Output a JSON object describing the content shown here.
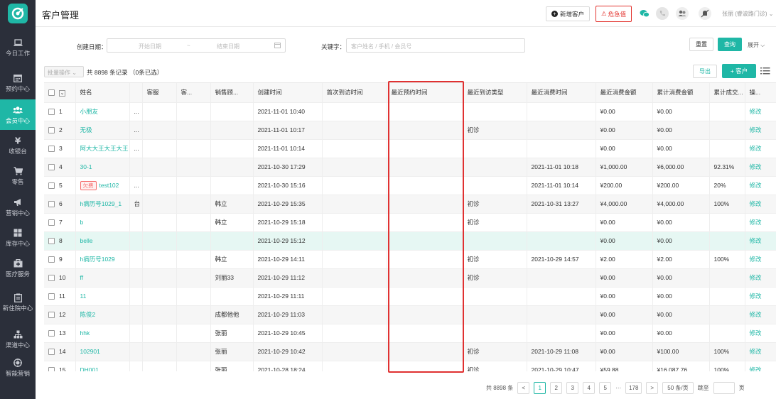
{
  "sidebar": {
    "items": [
      {
        "label": "今日工作",
        "icon": "laptop-icon"
      },
      {
        "label": "预约中心",
        "icon": "calendar-icon"
      },
      {
        "label": "会员中心",
        "icon": "members-icon",
        "active": true
      },
      {
        "label": "收银台",
        "icon": "yen-icon"
      },
      {
        "label": "零售",
        "icon": "cart-icon"
      },
      {
        "label": "营销中心",
        "icon": "megaphone-icon"
      },
      {
        "label": "库存中心",
        "icon": "grid-icon"
      },
      {
        "label": "医疗服务",
        "icon": "medkit-icon"
      },
      {
        "label": "住院中心",
        "icon": "clipboard-icon",
        "prefix": "新"
      },
      {
        "label": "渠道中心",
        "icon": "org-icon"
      },
      {
        "label": "智能营销",
        "icon": "target-icon"
      }
    ]
  },
  "header": {
    "title": "客户管理",
    "add_button": "新增客户",
    "urgent_button": "危急值",
    "user": "张丽 (睿波路门诊)"
  },
  "filter": {
    "date_label": "创建日期：",
    "start_placeholder": "开始日期",
    "range_sep": "~",
    "end_placeholder": "结束日期",
    "keyword_label": "关键字：",
    "keyword_placeholder": "客户姓名 / 手机 / 会员号",
    "reset": "重置",
    "query": "查询",
    "expand": "展开"
  },
  "toolbar": {
    "batch": "批量操作",
    "record_count": "共 8898 条记录 （0条已选）",
    "export": "导出",
    "new_customer": "+ 客户"
  },
  "table": {
    "columns": [
      "",
      "姓名",
      "",
      "客服",
      "客...",
      "销售顾...",
      "创建时间",
      "首次到访时间",
      "最近预约时间",
      "最近到访类型",
      "最近消费时间",
      "最近消费金额",
      "累计消费金额",
      "累计成交...",
      "操..."
    ],
    "rows": [
      {
        "no": "1",
        "name": "小朋友",
        "extra": "...",
        "sales": "",
        "created": "2021-11-01 10:40",
        "first": "",
        "appt": "",
        "type": "",
        "last_time": "",
        "last_amt": "¥0.00",
        "total_amt": "¥0.00",
        "rate": "",
        "op": "修改"
      },
      {
        "no": "2",
        "name": "无极",
        "extra": "...",
        "sales": "",
        "created": "2021-11-01 10:17",
        "first": "",
        "appt": "",
        "type": "初诊",
        "last_time": "",
        "last_amt": "¥0.00",
        "total_amt": "¥0.00",
        "rate": "",
        "op": "修改"
      },
      {
        "no": "3",
        "name": "阿大大王大王大王",
        "extra": "...",
        "sales": "",
        "created": "2021-11-01 10:14",
        "first": "",
        "appt": "",
        "type": "",
        "last_time": "",
        "last_amt": "¥0.00",
        "total_amt": "¥0.00",
        "rate": "",
        "op": "修改"
      },
      {
        "no": "4",
        "name": "30-1",
        "extra": "",
        "sales": "",
        "created": "2021-10-30 17:29",
        "first": "",
        "appt": "",
        "type": "",
        "last_time": "2021-11-01 10:18",
        "last_amt": "¥1,000.00",
        "total_amt": "¥6,000.00",
        "rate": "92.31%",
        "op": "修改"
      },
      {
        "no": "5",
        "name": "test102",
        "tag": "欠费",
        "extra": "...",
        "sales": "",
        "created": "2021-10-30 15:16",
        "first": "",
        "appt": "",
        "type": "",
        "last_time": "2021-11-01 10:14",
        "last_amt": "¥200.00",
        "total_amt": "¥200.00",
        "rate": "20%",
        "op": "修改"
      },
      {
        "no": "6",
        "name": "h病历号1029_1",
        "extra": "台",
        "sales": "韩立",
        "created": "2021-10-29 15:35",
        "first": "",
        "appt": "",
        "type": "初诊",
        "last_time": "2021-10-31 13:27",
        "last_amt": "¥4,000.00",
        "total_amt": "¥4,000.00",
        "rate": "100%",
        "op": "修改"
      },
      {
        "no": "7",
        "name": "b",
        "extra": "",
        "sales": "韩立",
        "created": "2021-10-29 15:18",
        "first": "",
        "appt": "",
        "type": "初诊",
        "last_time": "",
        "last_amt": "¥0.00",
        "total_amt": "¥0.00",
        "rate": "",
        "op": "修改"
      },
      {
        "no": "8",
        "name": "belle",
        "extra": "",
        "sales": "",
        "created": "2021-10-29 15:12",
        "first": "",
        "appt": "",
        "type": "",
        "last_time": "",
        "last_amt": "¥0.00",
        "total_amt": "¥0.00",
        "rate": "",
        "op": "修改",
        "highlight": true
      },
      {
        "no": "9",
        "name": "h病历号1029",
        "extra": "",
        "sales": "韩立",
        "created": "2021-10-29 14:11",
        "first": "",
        "appt": "",
        "type": "初诊",
        "last_time": "2021-10-29 14:57",
        "last_amt": "¥2.00",
        "total_amt": "¥2.00",
        "rate": "100%",
        "op": "修改"
      },
      {
        "no": "10",
        "name": "ff",
        "extra": "",
        "sales": "刘丽33",
        "created": "2021-10-29 11:12",
        "first": "",
        "appt": "",
        "type": "初诊",
        "last_time": "",
        "last_amt": "¥0.00",
        "total_amt": "¥0.00",
        "rate": "",
        "op": "修改"
      },
      {
        "no": "11",
        "name": "11",
        "extra": "",
        "sales": "",
        "created": "2021-10-29 11:11",
        "first": "",
        "appt": "",
        "type": "",
        "last_time": "",
        "last_amt": "¥0.00",
        "total_amt": "¥0.00",
        "rate": "",
        "op": "修改"
      },
      {
        "no": "12",
        "name": "陈俊2",
        "extra": "",
        "sales": "成都他他",
        "created": "2021-10-29 11:03",
        "first": "",
        "appt": "",
        "type": "",
        "last_time": "",
        "last_amt": "¥0.00",
        "total_amt": "¥0.00",
        "rate": "",
        "op": "修改"
      },
      {
        "no": "13",
        "name": "hhk",
        "extra": "",
        "sales": "张丽",
        "created": "2021-10-29 10:45",
        "first": "",
        "appt": "",
        "type": "",
        "last_time": "",
        "last_amt": "¥0.00",
        "total_amt": "¥0.00",
        "rate": "",
        "op": "修改"
      },
      {
        "no": "14",
        "name": "102901",
        "extra": "",
        "sales": "张丽",
        "created": "2021-10-29 10:42",
        "first": "",
        "appt": "",
        "type": "初诊",
        "last_time": "2021-10-29 11:08",
        "last_amt": "¥0.00",
        "total_amt": "¥100.00",
        "rate": "100%",
        "op": "修改"
      },
      {
        "no": "15",
        "name": "DH001",
        "extra": "",
        "sales": "张丽",
        "created": "2021-10-28 18:24",
        "first": "",
        "appt": "",
        "type": "初诊",
        "last_time": "2021-10-29 10:47",
        "last_amt": "¥59.88",
        "total_amt": "¥16,087.76",
        "rate": "100%",
        "op": "修改"
      }
    ]
  },
  "pagination": {
    "total": "共 8898 条",
    "prev": "<",
    "pages": [
      "1",
      "2",
      "3",
      "4",
      "5"
    ],
    "ellipsis": "···",
    "last": "178",
    "next": ">",
    "page_size": "50 条/页",
    "jump_label": "跳至",
    "jump_suffix": "页"
  },
  "colors": {
    "accent": "#1fb7a6",
    "sidebar": "#2b2f3a",
    "danger": "#e3342f"
  }
}
